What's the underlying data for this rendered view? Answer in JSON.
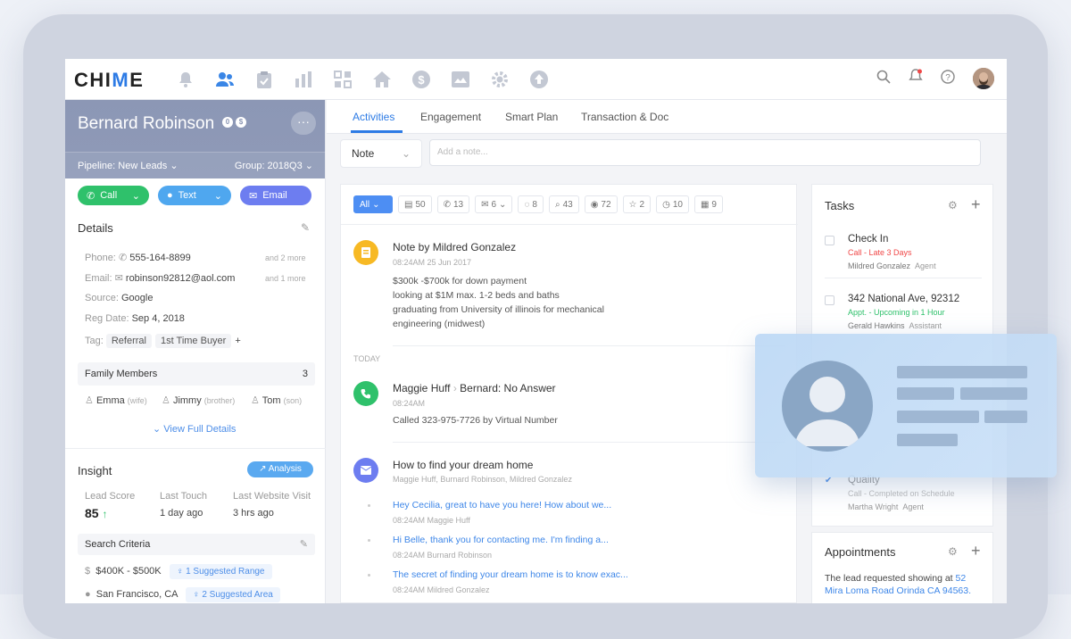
{
  "app": {
    "logo_pre": "CHI",
    "logo_accent": "M",
    "logo_post": "E"
  },
  "nav": {
    "icons": [
      "bell-icon",
      "people-icon",
      "clipboard-icon",
      "bar-chart-icon",
      "grid-icon",
      "home-icon",
      "dollar-icon",
      "image-icon",
      "gear-icon",
      "upload-icon"
    ]
  },
  "header_right": {
    "icons": [
      "search-icon",
      "notification-bell-icon",
      "help-icon",
      "avatar"
    ]
  },
  "lead": {
    "name": "Bernard Robinson",
    "badges": [
      "0",
      "$"
    ],
    "pipeline": "Pipeline: New Leads",
    "group": "Group: 2018Q3",
    "more": "···"
  },
  "actions": {
    "call": "Call",
    "text": "Text",
    "email": "Email"
  },
  "details": {
    "title": "Details",
    "phone_label": "Phone:",
    "phone": "555-164-8899",
    "phone_more": "and 2 more",
    "email_label": "Email:",
    "email": "robinson92812@aol.com",
    "email_more": "and 1 more",
    "source_label": "Source:",
    "source": "Google",
    "reg_label": "Reg Date:",
    "reg": "Sep 4, 2018",
    "tag_label": "Tag:",
    "tags": [
      "Referral",
      "1st Time Buyer"
    ],
    "tag_add": "+"
  },
  "family": {
    "title": "Family Members",
    "count": "3",
    "members": [
      {
        "name": "Emma",
        "rel": "(wife)"
      },
      {
        "name": "Jimmy",
        "rel": "(brother)"
      },
      {
        "name": "Tom",
        "rel": "(son)"
      }
    ],
    "view_full": "View Full Details"
  },
  "insight": {
    "title": "Insight",
    "analysis": "Analysis",
    "lead_score_label": "Lead Score",
    "lead_score": "85",
    "last_touch_label": "Last Touch",
    "last_touch": "1 day ago",
    "last_visit_label": "Last Website Visit",
    "last_visit": "3 hrs ago"
  },
  "search_criteria": {
    "title": "Search Criteria",
    "price": "$400K - $500K",
    "suggested": "1 Suggested Range",
    "area": "San Francisco, CA",
    "suggested2": "2 Suggested Area"
  },
  "tabs": [
    "Activities",
    "Engagement",
    "Smart Plan",
    "Transaction & Doc"
  ],
  "note": {
    "type": "Note",
    "placeholder": "Add a note..."
  },
  "filters": {
    "all": "All",
    "counts": [
      "50",
      "13",
      "6",
      "8",
      "43",
      "72",
      "2",
      "10",
      "9"
    ]
  },
  "timeline": {
    "note_title": "Note by Mildred Gonzalez",
    "note_meta": "08:24AM    25 Jun 2017",
    "note_body": "$300k -$700k for down payment\nlooking at $1M max. 1-2 beds and baths\ngraduating from University of illinois for mechanical\nengineering (midwest)",
    "today": "TODAY",
    "call_from": "Maggie Huff",
    "call_to": "Bernard: No Answer",
    "call_meta": "08:24AM",
    "call_body": "Called 323-975-7726 by Virtual Number",
    "email_title": "How to find your dream home",
    "email_meta": "Maggie Huff, Burnard Robinson, Mildred Gonzalez",
    "emails": [
      {
        "subject": "Hey Cecilia, great to have you here! How about we...",
        "meta": "08:24AM    Maggie Huff"
      },
      {
        "subject": "Hi Belle, thank you for contacting me. I'm finding a...",
        "meta": "08:24AM    Burnard Robinson"
      },
      {
        "subject": "The secret of finding your dream home is to know exac...",
        "meta": "08:24AM    Mildred Gonzalez"
      }
    ]
  },
  "tasks": {
    "title": "Tasks",
    "items": [
      {
        "title": "Check In",
        "status": "Call - Late 3 Days",
        "agent": "Mildred Gonzalez",
        "role": "Agent"
      },
      {
        "title": "342 National Ave, 92312",
        "status": "Appt. - Upcoming in 1 Hour",
        "agent": "Gerald Hawkins",
        "role": "Assistant"
      },
      {
        "title": "Quality",
        "status": "Call - Completed on Schedule",
        "agent": "Martha Wright",
        "role": "Agent"
      }
    ]
  },
  "appointments": {
    "title": "Appointments",
    "text": "The lead requested showing at ",
    "link": "52 Mira Loma Road Orinda CA 94563."
  },
  "colors": {
    "accent": "#2d7be5",
    "call": "#2fc16b",
    "text": "#4fa7ef",
    "email": "#6d7df0"
  }
}
